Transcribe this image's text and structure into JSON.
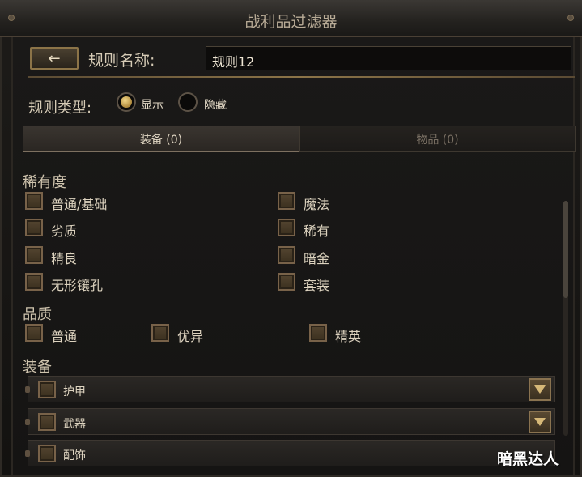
{
  "window": {
    "title": "战利品过滤器"
  },
  "header": {
    "back_icon": "back-arrow-icon",
    "rule_name_label": "规则名称:",
    "rule_name_value": "规则12"
  },
  "rule_type": {
    "label": "规则类型:",
    "options": [
      {
        "label": "显示",
        "selected": true
      },
      {
        "label": "隐藏",
        "selected": false
      }
    ]
  },
  "tabs": [
    {
      "label": "装备 (0)",
      "active": true
    },
    {
      "label": "物品 (0)",
      "active": false
    }
  ],
  "rarity": {
    "title": "稀有度",
    "items": [
      "普通/基础",
      "劣质",
      "精良",
      "无形镶孔",
      "魔法",
      "稀有",
      "暗金",
      "套装"
    ]
  },
  "quality": {
    "title": "品质",
    "items": [
      "普通",
      "优异",
      "精英"
    ]
  },
  "equipment": {
    "title": "装备",
    "items": [
      "护甲",
      "武器",
      "配饰"
    ],
    "expand_icon": "triangle-down-icon"
  },
  "watermark": "暗黑达人",
  "colors": {
    "accent_gold": "#b08a3c",
    "frame_bronze": "#8c7448"
  }
}
